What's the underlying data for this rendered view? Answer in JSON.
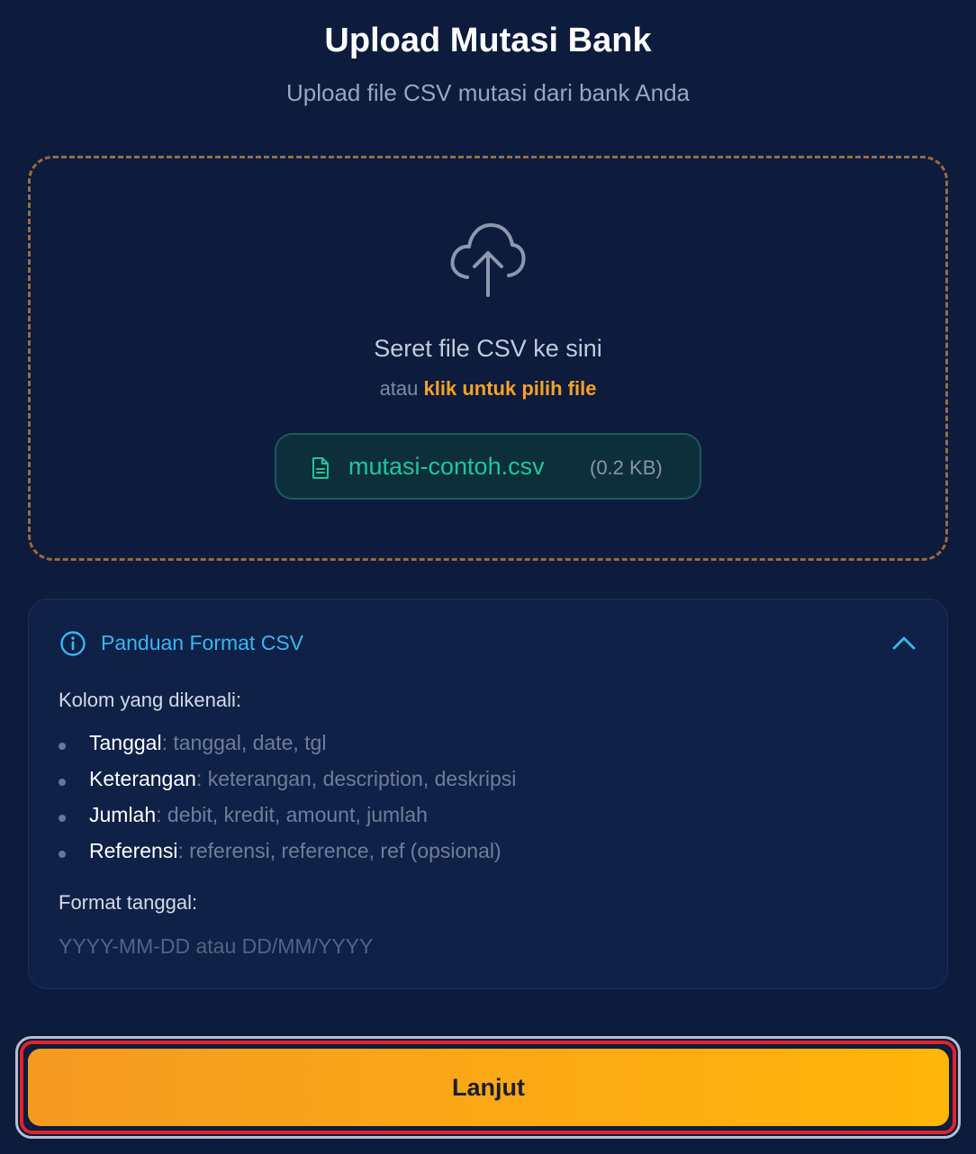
{
  "header": {
    "title": "Upload Mutasi Bank",
    "subtitle": "Upload file CSV mutasi dari bank Anda"
  },
  "dropzone": {
    "icon": "cloud-upload-icon",
    "main_text": "Seret file CSV ke sini",
    "sub_prefix": "atau",
    "sub_link": "klik untuk pilih file",
    "file": {
      "icon": "file-text-icon",
      "name": "mutasi-contoh.csv",
      "size": "(0.2 KB)"
    }
  },
  "guide": {
    "icon": "info-icon",
    "title": "Panduan Format CSV",
    "expanded": true,
    "columns_label": "Kolom yang dikenali:",
    "columns": [
      {
        "key": "Tanggal",
        "values": ": tanggal, date, tgl"
      },
      {
        "key": "Keterangan",
        "values": ": keterangan, description, deskripsi"
      },
      {
        "key": "Jumlah",
        "values": ": debit, kredit, amount, jumlah"
      },
      {
        "key": "Referensi",
        "values": ": referensi, reference, ref (opsional)"
      }
    ],
    "date_format_label": "Format tanggal:",
    "date_format_value": "YYYY-MM-DD atau DD/MM/YYYY"
  },
  "actions": {
    "next_label": "Lanjut"
  },
  "colors": {
    "background": "#0d1b3d",
    "accent": "#f5a226",
    "file_accent": "#21c59a",
    "info": "#38b7f2",
    "highlight": "#e0242b"
  }
}
